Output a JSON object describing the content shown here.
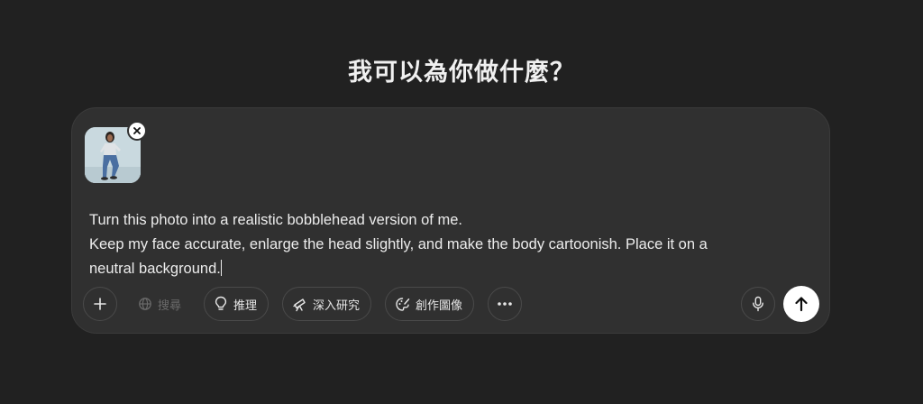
{
  "heading": "我可以為你做什麼？",
  "composer": {
    "attachment": {
      "icon": "photo-thumbnail",
      "remove_icon": "close-icon"
    },
    "prompt_lines": [
      "Turn this photo into a realistic bobblehead version of me.",
      "Keep my face accurate, enlarge the head slightly, and make the body cartoonish. Place it on a",
      "neutral background."
    ]
  },
  "toolbar": {
    "add_icon": "plus-icon",
    "search_label": "搜尋",
    "search_icon": "globe-icon",
    "reason_label": "推理",
    "reason_icon": "lightbulb-icon",
    "research_label": "深入研究",
    "research_icon": "telescope-icon",
    "create_image_label": "創作圖像",
    "create_image_icon": "palette-icon",
    "more_icon": "ellipsis-icon",
    "mic_icon": "microphone-icon",
    "send_icon": "arrow-up-icon"
  }
}
